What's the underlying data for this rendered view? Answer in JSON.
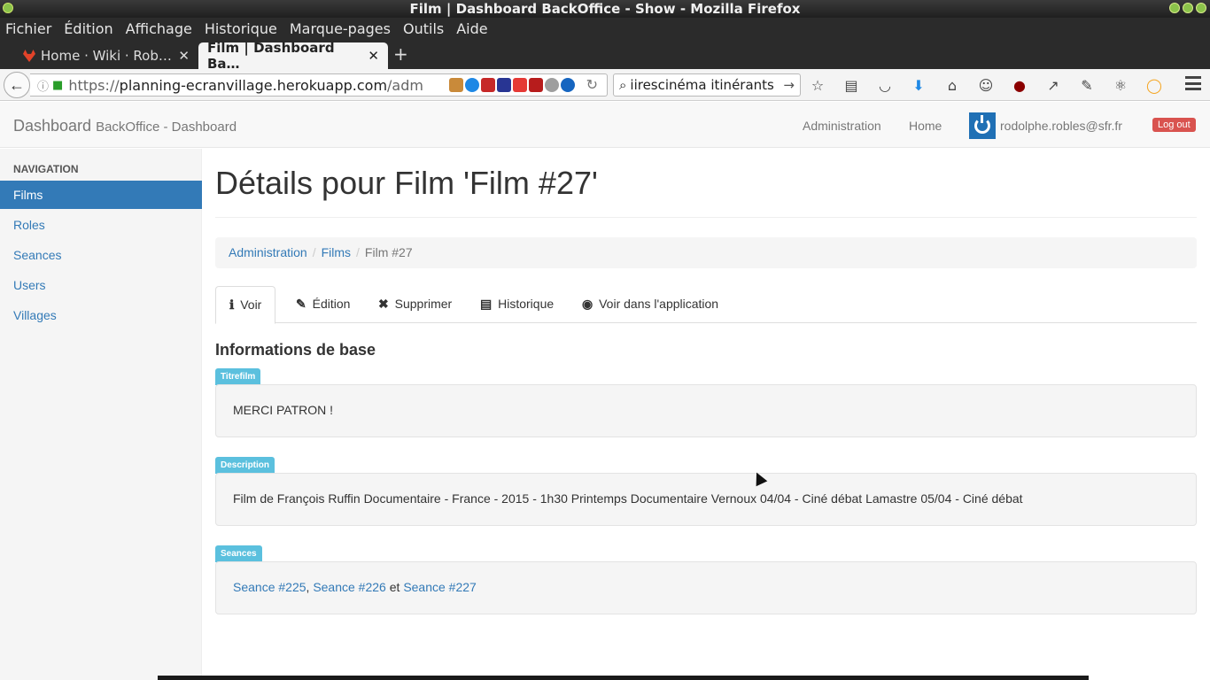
{
  "window": {
    "title": "Film | Dashboard BackOffice - Show - Mozilla Firefox"
  },
  "menubar": [
    "Fichier",
    "Édition",
    "Affichage",
    "Historique",
    "Marque-pages",
    "Outils",
    "Aide"
  ],
  "tabs": [
    {
      "label": "Home · Wiki · Rob…",
      "close": "✕"
    },
    {
      "label": "Film | Dashboard Ba…",
      "close": "✕"
    }
  ],
  "newtab": "+",
  "urlbar": {
    "prefix": "https://",
    "host": "planning-ecranvillage.herokuapp.com",
    "path": "/adm"
  },
  "searchbar": {
    "value": "iirescinéma itinérants"
  },
  "app": {
    "brand": "Dashboard",
    "brand_sub": "BackOffice - Dashboard",
    "header_links": [
      "Administration",
      "Home"
    ],
    "user_email": "rodolphe.robles@sfr.fr",
    "logout": "Log out"
  },
  "sidebar": {
    "header": "NAVIGATION",
    "items": [
      "Films",
      "Roles",
      "Seances",
      "Users",
      "Villages"
    ],
    "active_index": 0
  },
  "main": {
    "title": "Détails pour Film 'Film #27'",
    "breadcrumb": {
      "items": [
        "Administration",
        "Films"
      ],
      "current": "Film #27",
      "separator": "/"
    },
    "tabs": [
      {
        "icon": "ℹ",
        "label": "Voir"
      },
      {
        "icon": "✎",
        "label": "Édition"
      },
      {
        "icon": "✖",
        "label": "Supprimer"
      },
      {
        "icon": "▤",
        "label": "Historique"
      },
      {
        "icon": "◉",
        "label": "Voir dans l'application"
      }
    ],
    "section_title": "Informations de base",
    "fields": [
      {
        "label": "Titrefilm",
        "value": "MERCI PATRON !"
      },
      {
        "label": "Description",
        "value": "Film de François Ruffin Documentaire - France - 2015 - 1h30 Printemps Documentaire Vernoux 04/04 - Ciné débat Lamastre 05/04 - Ciné débat"
      },
      {
        "label": "Seances",
        "links": [
          "Seance #225",
          "Seance #226",
          "Seance #227"
        ],
        "sep1": ",",
        "sep2": "et"
      }
    ]
  },
  "colors": {
    "primary": "#337ab7",
    "info_label": "#5bc0de",
    "danger": "#d9534f"
  }
}
